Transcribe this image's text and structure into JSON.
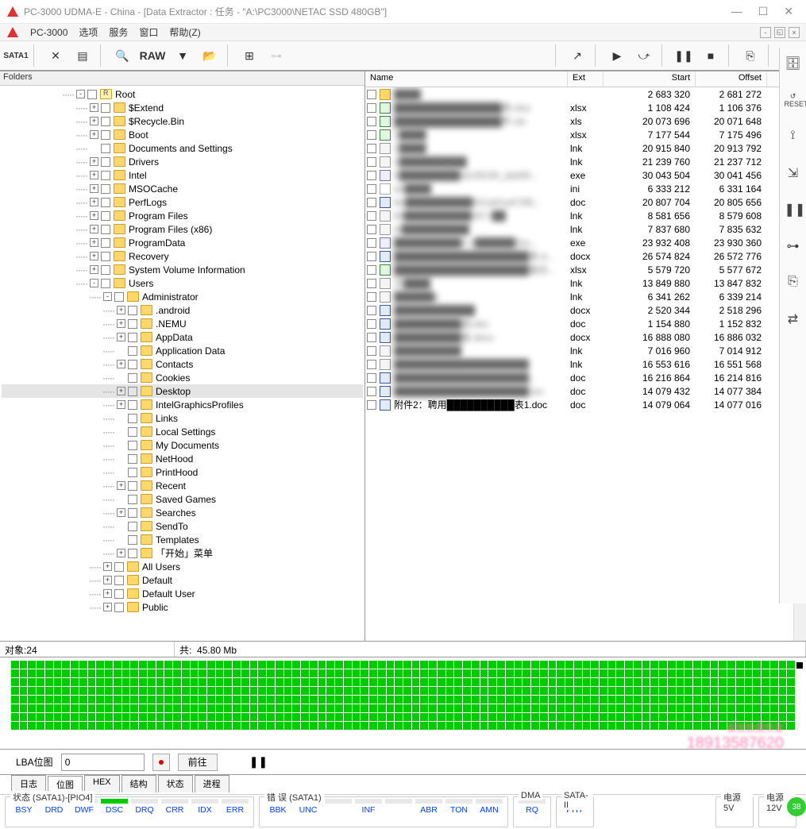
{
  "window": {
    "title": "PC-3000 UDMA-E - China - [Data Extractor : 任务 - \"A:\\PC3000\\NETAC SSD 480GB\"]"
  },
  "menubar": {
    "app": "PC-3000",
    "items": [
      "选项",
      "服务",
      "窗口",
      "帮助(Z)"
    ]
  },
  "toolbar": {
    "sata": "SATA1",
    "raw": "RAW"
  },
  "folders_header": "Folders",
  "tree": [
    {
      "depth": 0,
      "exp": "-",
      "root": true,
      "label": "Root"
    },
    {
      "depth": 1,
      "exp": "+",
      "label": "$Extend"
    },
    {
      "depth": 1,
      "exp": "+",
      "label": "$Recycle.Bin"
    },
    {
      "depth": 1,
      "exp": "+",
      "label": "Boot"
    },
    {
      "depth": 1,
      "exp": " ",
      "label": "Documents and Settings"
    },
    {
      "depth": 1,
      "exp": "+",
      "label": "Drivers"
    },
    {
      "depth": 1,
      "exp": "+",
      "label": "Intel"
    },
    {
      "depth": 1,
      "exp": "+",
      "label": "MSOCache"
    },
    {
      "depth": 1,
      "exp": "+",
      "label": "PerfLogs"
    },
    {
      "depth": 1,
      "exp": "+",
      "label": "Program Files"
    },
    {
      "depth": 1,
      "exp": "+",
      "label": "Program Files (x86)"
    },
    {
      "depth": 1,
      "exp": "+",
      "label": "ProgramData"
    },
    {
      "depth": 1,
      "exp": "+",
      "label": "Recovery"
    },
    {
      "depth": 1,
      "exp": "+",
      "label": "System Volume Information"
    },
    {
      "depth": 1,
      "exp": "-",
      "label": "Users"
    },
    {
      "depth": 2,
      "exp": "-",
      "label": "Administrator"
    },
    {
      "depth": 3,
      "exp": "+",
      "label": ".android"
    },
    {
      "depth": 3,
      "exp": "+",
      "label": ".NEMU"
    },
    {
      "depth": 3,
      "exp": "+",
      "label": "AppData"
    },
    {
      "depth": 3,
      "exp": " ",
      "label": "Application Data"
    },
    {
      "depth": 3,
      "exp": "+",
      "label": "Contacts"
    },
    {
      "depth": 3,
      "exp": " ",
      "label": "Cookies"
    },
    {
      "depth": 3,
      "exp": "+",
      "label": "Desktop",
      "selected": true
    },
    {
      "depth": 3,
      "exp": "+",
      "label": "IntelGraphicsProfiles"
    },
    {
      "depth": 3,
      "exp": " ",
      "label": "Links"
    },
    {
      "depth": 3,
      "exp": " ",
      "label": "Local Settings"
    },
    {
      "depth": 3,
      "exp": " ",
      "label": "My Documents"
    },
    {
      "depth": 3,
      "exp": " ",
      "label": "NetHood"
    },
    {
      "depth": 3,
      "exp": " ",
      "label": "PrintHood"
    },
    {
      "depth": 3,
      "exp": "+",
      "label": "Recent"
    },
    {
      "depth": 3,
      "exp": " ",
      "label": "Saved Games"
    },
    {
      "depth": 3,
      "exp": "+",
      "label": "Searches"
    },
    {
      "depth": 3,
      "exp": " ",
      "label": "SendTo"
    },
    {
      "depth": 3,
      "exp": " ",
      "label": "Templates"
    },
    {
      "depth": 3,
      "exp": "+",
      "label": "「开始」菜单"
    },
    {
      "depth": 2,
      "exp": "+",
      "label": "All Users"
    },
    {
      "depth": 2,
      "exp": "+",
      "label": "Default"
    },
    {
      "depth": 2,
      "exp": "+",
      "label": "Default User"
    },
    {
      "depth": 2,
      "exp": "+",
      "label": "Public"
    }
  ],
  "file_cols": {
    "name": "Name",
    "ext": "Ext",
    "start": "Start",
    "offset": "Offset"
  },
  "files": [
    {
      "icon": "fold",
      "name": "████",
      "ext": "",
      "start": "2 683 320",
      "offset": "2 681 272",
      "blur": true
    },
    {
      "icon": "xls",
      "name": "████████████████表.xlsx",
      "ext": "xlsx",
      "start": "1 108 424",
      "offset": "1 106 376",
      "blur": true
    },
    {
      "icon": "xls",
      "name": "████████████████件.xls",
      "ext": "xls",
      "start": "20 073 696",
      "offset": "20 071 648",
      "blur": true
    },
    {
      "icon": "xls",
      "name": "2████",
      "ext": "xlsx",
      "start": "7 177 544",
      "offset": "7 175 496",
      "blur": true
    },
    {
      "icon": "lnk",
      "name": "2████",
      "ext": "lnk",
      "start": "20 915 840",
      "offset": "20 913 792",
      "blur": true
    },
    {
      "icon": "lnk",
      "name": "2██████████",
      "ext": "lnk",
      "start": "21 239 760",
      "offset": "21 237 712",
      "blur": true
    },
    {
      "icon": "exe",
      "name": "5█████████id125230_dzb55...",
      "ext": "exe",
      "start": "30 043 504",
      "offset": "30 041 456",
      "blur": true
    },
    {
      "icon": "ini",
      "name": "de████",
      "ext": "ini",
      "start": "6 333 212",
      "offset": "6 331 164",
      "blur": true
    },
    {
      "icon": "doc",
      "name": "far██████████621a01a472f5...",
      "ext": "doc",
      "start": "20 807 704",
      "offset": "20 805 656",
      "blur": true
    },
    {
      "icon": "lnk",
      "name": "Mi██████████007.l██",
      "ext": "lnk",
      "start": "8 581 656",
      "offset": "8 579 608",
      "blur": true
    },
    {
      "icon": "lnk",
      "name": "M██████████",
      "ext": "lnk",
      "start": "7 837 680",
      "offset": "7 835 632",
      "blur": true
    },
    {
      "icon": "exe",
      "name": "██████████0.2██████3xx...",
      "ext": "exe",
      "start": "23 932 408",
      "offset": "23 930 360",
      "blur": true
    },
    {
      "icon": "doc",
      "name": "████████████████████表.d...",
      "ext": "docx",
      "start": "26 574 824",
      "offset": "26 572 776",
      "blur": true
    },
    {
      "icon": "xls",
      "name": "████████████████████查办...",
      "ext": "xlsx",
      "start": "5 579 720",
      "offset": "5 577 672",
      "blur": true
    },
    {
      "icon": "lnk",
      "name": "文████",
      "ext": "lnk",
      "start": "13 849 880",
      "offset": "13 847 832",
      "blur": true
    },
    {
      "icon": "lnk",
      "name": "██████x",
      "ext": "lnk",
      "start": "6 341 262",
      "offset": "6 339 214",
      "blur": true
    },
    {
      "icon": "doc",
      "name": "████████████",
      "ext": "docx",
      "start": "2 520 344",
      "offset": "2 518 296",
      "blur": true
    },
    {
      "icon": "doc",
      "name": "██████████函.doc",
      "ext": "doc",
      "start": "1 154 880",
      "offset": "1 152 832",
      "blur": true
    },
    {
      "icon": "doc",
      "name": "██████████复.docx",
      "ext": "docx",
      "start": "16 888 080",
      "offset": "16 886 032",
      "blur": true
    },
    {
      "icon": "lnk",
      "name": "██████████",
      "ext": "lnk",
      "start": "7 016 960",
      "offset": "7 014 912",
      "blur": true
    },
    {
      "icon": "lnk",
      "name": "████████████████████",
      "ext": "lnk",
      "start": "16 553 616",
      "offset": "16 551 568",
      "blur": true
    },
    {
      "icon": "doc",
      "name": "████████████████████...",
      "ext": "doc",
      "start": "16 216 864",
      "offset": "16 214 816",
      "blur": true
    },
    {
      "icon": "doc",
      "name": "████████████████████.loc",
      "ext": "doc",
      "start": "14 079 432",
      "offset": "14 077 384",
      "blur": true
    },
    {
      "icon": "doc",
      "name": "附件2：聘用██████████表1.doc",
      "ext": "doc",
      "start": "14 079 064",
      "offset": "14 077 016",
      "blur": false
    }
  ],
  "stats": {
    "objects_label": "对象:",
    "objects": "24",
    "total_label": "共:",
    "total": "45.80 Mb"
  },
  "lba": {
    "label": "LBA位图",
    "value": "0",
    "goto": "前往"
  },
  "tabs": [
    "日志",
    "位图",
    "HEX",
    "结构",
    "状态",
    "进程"
  ],
  "active_tab": 1,
  "status_groups": {
    "state": {
      "title": "状态 (SATA1)-[PIO4]",
      "items": [
        {
          "label": "BSY",
          "on": false
        },
        {
          "label": "DRD",
          "on": true
        },
        {
          "label": "DWF",
          "on": false
        },
        {
          "label": "DSC",
          "on": true
        },
        {
          "label": "DRQ",
          "on": false
        },
        {
          "label": "CRR",
          "on": false
        },
        {
          "label": "IDX",
          "on": false
        },
        {
          "label": "ERR",
          "on": false
        }
      ]
    },
    "error": {
      "title": "错 误 (SATA1)",
      "items": [
        {
          "label": "BBK",
          "on": false
        },
        {
          "label": "UNC",
          "on": false
        },
        {
          "label": "",
          "on": false
        },
        {
          "label": "INF",
          "on": false
        },
        {
          "label": "",
          "on": false
        },
        {
          "label": "ABR",
          "on": false
        },
        {
          "label": "TON",
          "on": false
        },
        {
          "label": "AMN",
          "on": false
        }
      ]
    },
    "dma": {
      "title": "DMA",
      "items": [
        {
          "label": "RQ",
          "on": false
        }
      ]
    },
    "sata2": {
      "title": "SATA-II",
      "items": [
        {
          "label": "PHY",
          "on": true
        }
      ]
    },
    "pwr5": {
      "title": "电源 5V",
      "items": [
        {
          "label": "5V",
          "on": true
        }
      ]
    },
    "pwr12": {
      "title": "电源 12V",
      "items": [
        {
          "label": "12V",
          "on": true
        }
      ]
    }
  },
  "watermark": {
    "text": "盘首数据恢复",
    "phone": "18913587620"
  },
  "badge": "38",
  "sidebar_icons": [
    "db",
    "reset",
    "clamp",
    "measure",
    "pause",
    "link",
    "copy",
    "adjust"
  ]
}
